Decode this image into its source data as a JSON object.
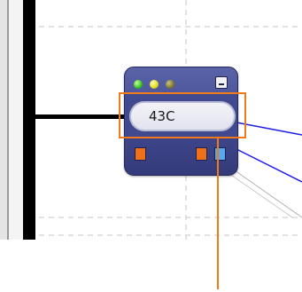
{
  "node": {
    "readout_value": "43C",
    "status_indicators": [
      "green-led",
      "yellow-led",
      "olive-led"
    ],
    "ports": [
      {
        "name": "orange-port",
        "color": "#f07018"
      },
      {
        "name": "orange-port",
        "color": "#f07018"
      },
      {
        "name": "blue-port",
        "color": "#58a8f0"
      }
    ]
  },
  "colors": {
    "node_body": "#3f468c",
    "wire_black": "#000000",
    "wire_blue": "#1e1ee6",
    "grid_dashed": "#d8d8d8",
    "selection_highlight": "#f07a1a"
  }
}
